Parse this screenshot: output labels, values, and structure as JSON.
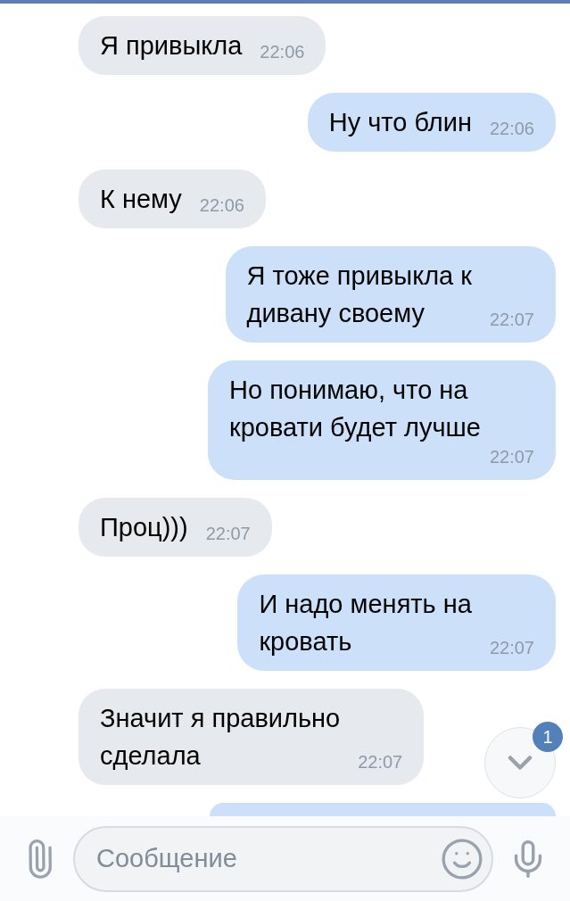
{
  "messages": [
    {
      "kind": "text",
      "outgoing": false,
      "text": "Я привыкла",
      "time": "22:06"
    },
    {
      "kind": "text",
      "outgoing": true,
      "text": "Ну что блин",
      "time": "22:06"
    },
    {
      "kind": "text",
      "outgoing": false,
      "text": "К нему",
      "time": "22:06"
    },
    {
      "kind": "text",
      "outgoing": true,
      "text": "Я тоже привыкла к\nдивану своему",
      "time": "22:07"
    },
    {
      "kind": "text",
      "outgoing": true,
      "text": "Но понимаю, что на\nкровати будет лучше",
      "time": "22:07"
    },
    {
      "kind": "text",
      "outgoing": false,
      "text": "Проц)))",
      "time": "22:07"
    },
    {
      "kind": "text",
      "outgoing": true,
      "text": "И надо менять на\nкровать",
      "time": "22:07"
    },
    {
      "kind": "text",
      "outgoing": false,
      "text": "Значит я правильно\nсделала",
      "time": "22:07"
    },
    {
      "kind": "partial",
      "outgoing": true
    }
  ],
  "scroll_down": {
    "badge": "1"
  },
  "composer": {
    "placeholder": "Сообщение"
  }
}
